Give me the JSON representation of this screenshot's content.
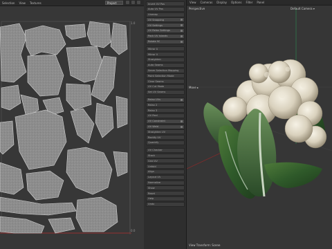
{
  "uv_editor": {
    "menu": [
      "Selection",
      "View",
      "Textures"
    ],
    "project_select": "Project",
    "tick_top_right": "1.0",
    "tick_bottom_right": "0.0"
  },
  "tool_panel": {
    "items": [
      {
        "label": "Invert UV Pos",
        "group": false
      },
      {
        "label": "Auto UV Pos",
        "group": false
      },
      {
        "label": "Unwrap",
        "group": false
      },
      {
        "label": "UV Snapping",
        "group": true
      },
      {
        "label": "UV Settings",
        "group": true
      },
      {
        "label": "UV Relax Settings",
        "group": true
      },
      {
        "label": "Pack UV Islands",
        "group": true
      },
      {
        "label": "Rotate 90",
        "group": true
      },
      {
        "label": "Mirror U",
        "group": false
      },
      {
        "label": "Mirror V",
        "group": false
      },
      {
        "label": "Straighten",
        "group": false
      },
      {
        "label": "Auto Seams",
        "group": false
      },
      {
        "label": "Seam Selection Mapping",
        "group": false
      },
      {
        "label": "Point Selection Mode",
        "group": false
      },
      {
        "label": "Clear Seams",
        "group": false
      },
      {
        "label": "UV Cut Mode",
        "group": false
      },
      {
        "label": "Set UV Seams",
        "group": false
      },
      {
        "label": "Relax UVs",
        "group": true
      },
      {
        "label": "Relax 2",
        "group": false
      },
      {
        "label": "Relax 3",
        "group": false
      },
      {
        "label": "UV Peel",
        "group": false
      },
      {
        "label": "UV Constraint",
        "group": true
      },
      {
        "label": "UV Weld",
        "group": true
      },
      {
        "label": "Straighten UV",
        "group": false
      },
      {
        "label": "Rectify UV",
        "group": false
      },
      {
        "label": "Quadrify",
        "group": false
      },
      {
        "label": "UV Checker",
        "group": false
      },
      {
        "label": "Stack",
        "group": false
      },
      {
        "label": "Grid UV",
        "group": false
      },
      {
        "label": "Unfold",
        "group": false
      },
      {
        "label": "Align",
        "group": false
      },
      {
        "label": "Layout UV",
        "group": false
      },
      {
        "label": "Normalize",
        "group": false
      },
      {
        "label": "Show",
        "group": false
      },
      {
        "label": "Reset",
        "group": false
      },
      {
        "label": "Help",
        "group": false
      },
      {
        "label": "Undo",
        "group": false
      }
    ]
  },
  "viewport": {
    "menu": [
      "View",
      "Cameras",
      "Display",
      "Options",
      "Filter",
      "Panel"
    ],
    "label_top": "Perspective",
    "label_camera": "Default Camera ▾",
    "label_left": "Move ▸",
    "label_bottom": "View Transform: Scene"
  }
}
